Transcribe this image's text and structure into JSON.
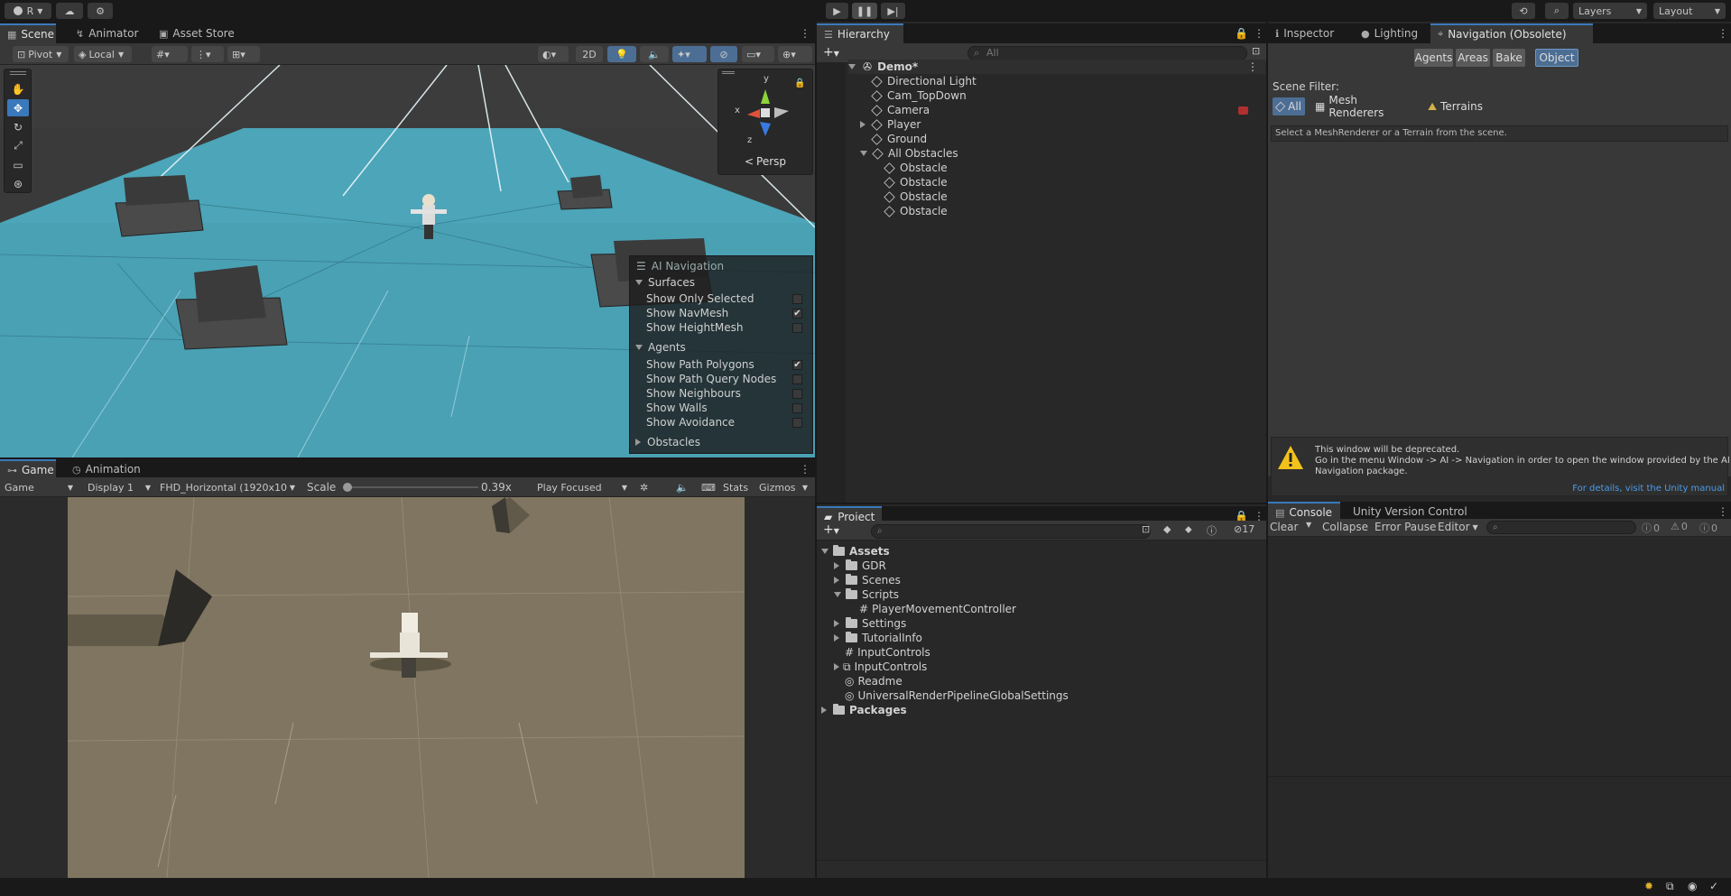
{
  "toolbar": {
    "account_label": "R",
    "layers_label": "Layers",
    "layout_label": "Layout"
  },
  "scene_tabs": {
    "scene": "Scene",
    "animator": "Animator",
    "asset_store": "Asset Store"
  },
  "scene_toolbar": {
    "pivot": "Pivot",
    "local": "Local",
    "mode_2d": "2D"
  },
  "gizmo": {
    "x": "x",
    "y": "y",
    "z": "z",
    "persp": "Persp"
  },
  "ai_nav_overlay": {
    "title": "AI Navigation",
    "surfaces_header": "Surfaces",
    "surfaces": [
      {
        "label": "Show Only Selected",
        "checked": false
      },
      {
        "label": "Show NavMesh",
        "checked": true
      },
      {
        "label": "Show HeightMesh",
        "checked": false
      }
    ],
    "agents_header": "Agents",
    "agents": [
      {
        "label": "Show Path Polygons",
        "checked": true
      },
      {
        "label": "Show Path Query Nodes",
        "checked": false
      },
      {
        "label": "Show Neighbours",
        "checked": false
      },
      {
        "label": "Show Walls",
        "checked": false
      },
      {
        "label": "Show Avoidance",
        "checked": false
      }
    ],
    "obstacles_header": "Obstacles"
  },
  "game_tabs": {
    "game": "Game",
    "animation": "Animation"
  },
  "game_toolbar": {
    "game_select": "Game",
    "display": "Display 1",
    "resolution": "FHD_Horizontal (1920x10",
    "scale_label": "Scale",
    "scale_value": "0.39x",
    "scale_fraction": 0.02,
    "play_focused": "Play Focused",
    "stats": "Stats",
    "gizmos": "Gizmos"
  },
  "hierarchy": {
    "tab": "Hierarchy",
    "search_placeholder": "All",
    "scene_name": "Demo*",
    "items": [
      {
        "label": "Directional Light"
      },
      {
        "label": "Cam_TopDown"
      },
      {
        "label": "Camera"
      },
      {
        "label": "Player"
      },
      {
        "label": "Ground"
      },
      {
        "label": "All Obstacles"
      },
      {
        "label": "Obstacle"
      },
      {
        "label": "Obstacle"
      },
      {
        "label": "Obstacle"
      },
      {
        "label": "Obstacle"
      }
    ]
  },
  "inspector_tabs": {
    "inspector": "Inspector",
    "lighting": "Lighting",
    "navigation": "Navigation (Obsolete)"
  },
  "navigation": {
    "buttons": [
      "Agents",
      "Areas",
      "Bake",
      "Object"
    ],
    "scene_filter_label": "Scene Filter:",
    "filters": [
      "All",
      "Mesh Renderers",
      "Terrains"
    ],
    "hint": "Select a MeshRenderer or a Terrain from the scene.",
    "warning_line1": "This window will be deprecated.",
    "warning_line2": "Go in the menu Window -> AI -> Navigation in order to open the window provided by the AI",
    "warning_line3": "Navigation package.",
    "details_link": "For details, visit the Unity manual"
  },
  "project": {
    "tab": "Project",
    "hidden_count": "17",
    "tree": [
      {
        "label": "Assets"
      },
      {
        "label": "GDR"
      },
      {
        "label": "Scenes"
      },
      {
        "label": "Scripts"
      },
      {
        "label": "PlayerMovementController"
      },
      {
        "label": "Settings"
      },
      {
        "label": "TutorialInfo"
      },
      {
        "label": "InputControls"
      },
      {
        "label": "InputControls"
      },
      {
        "label": "Readme"
      },
      {
        "label": "UniversalRenderPipelineGlobalSettings"
      },
      {
        "label": "Packages"
      }
    ]
  },
  "console": {
    "tab": "Console",
    "vc_tab": "Unity Version Control",
    "clear": "Clear",
    "collapse": "Collapse",
    "error_pause": "Error Pause",
    "editor": "Editor",
    "log_count": "0",
    "warn_count": "0",
    "error_count": "0"
  },
  "colors": {
    "accent": "#3a79bb",
    "scene_floor": "#4ba3b6",
    "game_floor": "#7f7560"
  }
}
